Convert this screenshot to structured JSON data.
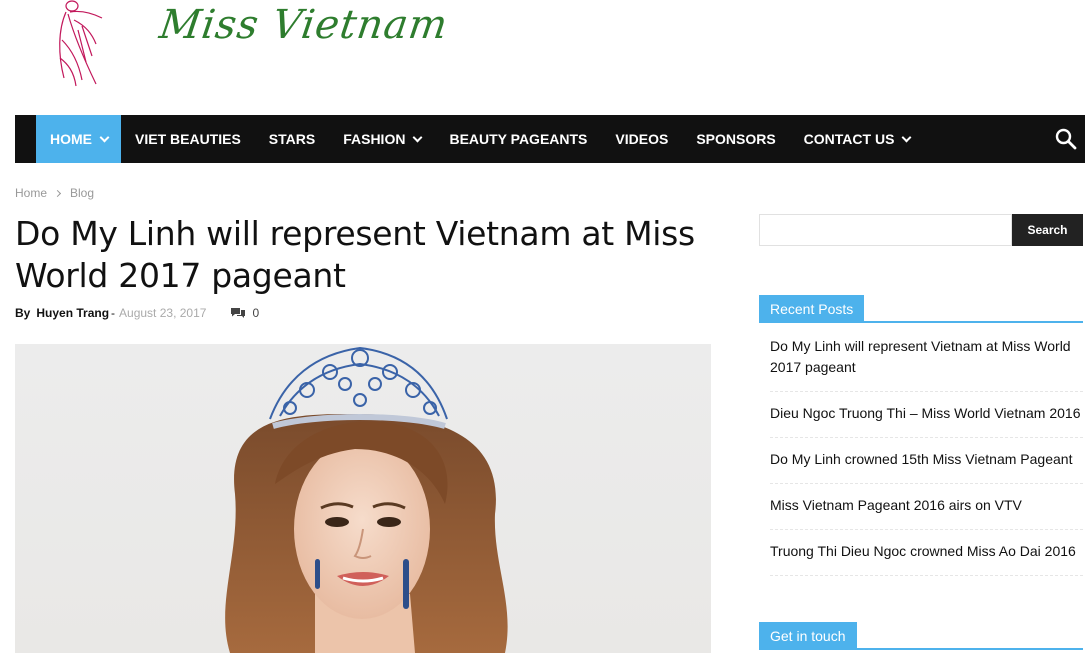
{
  "logo": {
    "text": "Miss Vietnam"
  },
  "nav": {
    "items": [
      {
        "label": "HOME",
        "dropdown": true,
        "active": true
      },
      {
        "label": "VIET BEAUTIES",
        "dropdown": false
      },
      {
        "label": "STARS",
        "dropdown": false
      },
      {
        "label": "FASHION",
        "dropdown": true
      },
      {
        "label": "BEAUTY PAGEANTS",
        "dropdown": false
      },
      {
        "label": "VIDEOS",
        "dropdown": false
      },
      {
        "label": "SPONSORS",
        "dropdown": false
      },
      {
        "label": "CONTACT US",
        "dropdown": true
      }
    ],
    "search_icon": "search-icon",
    "active_color": "#4db2ec",
    "bar_color": "#111111"
  },
  "breadcrumb": {
    "home": "Home",
    "current": "Blog"
  },
  "post": {
    "title": "Do My Linh will represent Vietnam at Miss World 2017 pageant",
    "by": "By",
    "author": "Huyen Trang",
    "date": "August 23, 2017",
    "comment_count": "0"
  },
  "sidebar": {
    "search_placeholder": "",
    "search_button": "Search",
    "recent_title": "Recent Posts",
    "recent_posts": [
      "Do My Linh will represent Vietnam at Miss World 2017 pageant",
      "Dieu Ngoc Truong Thi – Miss World Vietnam 2016",
      "Do My Linh crowned 15th Miss Vietnam Pageant",
      "Miss Vietnam Pageant 2016 airs on VTV",
      "Truong Thi Dieu Ngoc crowned Miss Ao Dai 2016"
    ],
    "contact_title": "Get in touch"
  }
}
